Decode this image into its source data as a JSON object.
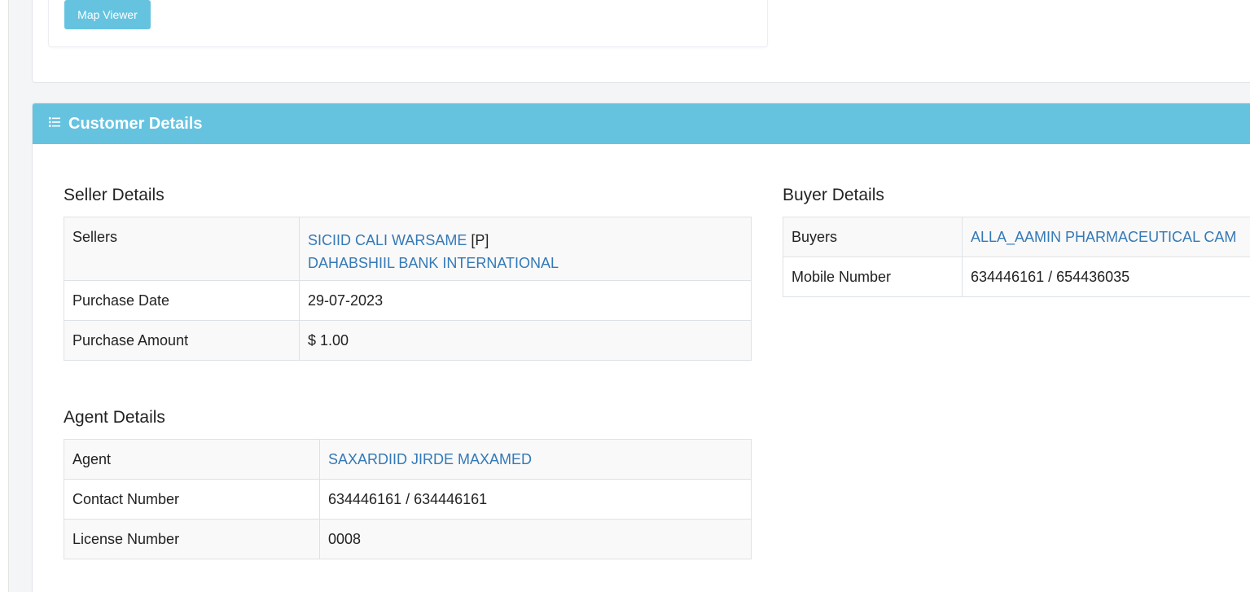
{
  "top_card": {
    "map_viewer_label": "Map Viewer"
  },
  "customer_details": {
    "title": "Customer Details",
    "seller": {
      "section_title": "Seller Details",
      "sellers_label": "Sellers",
      "seller_1_name": "SICIID CALI WARSAME",
      "seller_1_suffix": "[P]",
      "seller_2_name": "DAHABSHIIL BANK INTERNATIONAL",
      "purchase_date_label": "Purchase Date",
      "purchase_date": "29-07-2023",
      "purchase_amount_label": "Purchase Amount",
      "purchase_amount": "$ 1.00"
    },
    "buyer": {
      "section_title": "Buyer Details",
      "buyers_label": "Buyers",
      "buyer_name": "ALLA_AAMIN PHARMACEUTICAL CAM",
      "mobile_label": "Mobile Number",
      "mobile": "634446161 / 654436035"
    },
    "agent": {
      "section_title": "Agent Details",
      "agent_label": "Agent",
      "agent_name": "SAXARDIID JIRDE MAXAMED",
      "contact_label": "Contact Number",
      "contact": "634446161 / 634446161",
      "license_label": "License Number",
      "license": "0008"
    }
  },
  "colors": {
    "header_bg": "#66c3e0",
    "link": "#3479b7"
  },
  "icons": {
    "header_icon": "list-icon"
  }
}
